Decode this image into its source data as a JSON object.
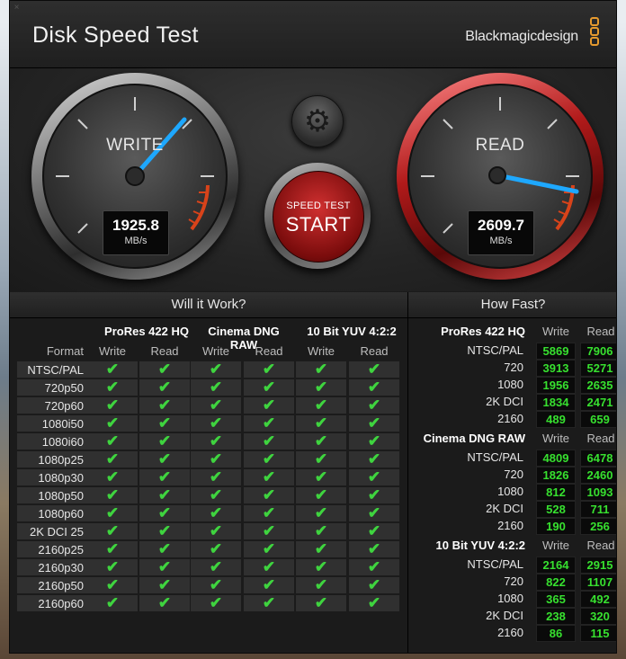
{
  "app": {
    "title": "Disk Speed Test",
    "brand": "Blackmagicdesign",
    "close_glyph": "×"
  },
  "gauges": {
    "write": {
      "label": "WRITE",
      "value": "1925.8",
      "unit": "MB/s"
    },
    "read": {
      "label": "READ",
      "value": "2609.7",
      "unit": "MB/s"
    }
  },
  "start_button": {
    "line1": "SPEED TEST",
    "line2": "START"
  },
  "settings_icon": "gear-icon",
  "will_it_work": {
    "title": "Will it Work?",
    "format_header": "Format",
    "groups": [
      "ProRes 422 HQ",
      "Cinema DNG RAW",
      "10 Bit YUV 4:2:2"
    ],
    "subheaders": [
      "Write",
      "Read"
    ],
    "check_glyph": "✔",
    "formats": [
      "NTSC/PAL",
      "720p50",
      "720p60",
      "1080i50",
      "1080i60",
      "1080p25",
      "1080p30",
      "1080p50",
      "1080p60",
      "2K DCI 25",
      "2160p25",
      "2160p30",
      "2160p50",
      "2160p60"
    ]
  },
  "how_fast": {
    "title": "How Fast?",
    "subheaders": [
      "Write",
      "Read"
    ],
    "groups": [
      {
        "name": "ProRes 422 HQ",
        "rows": [
          {
            "label": "NTSC/PAL",
            "write": "5869",
            "read": "7906"
          },
          {
            "label": "720",
            "write": "3913",
            "read": "5271"
          },
          {
            "label": "1080",
            "write": "1956",
            "read": "2635"
          },
          {
            "label": "2K DCI",
            "write": "1834",
            "read": "2471"
          },
          {
            "label": "2160",
            "write": "489",
            "read": "659"
          }
        ]
      },
      {
        "name": "Cinema DNG RAW",
        "rows": [
          {
            "label": "NTSC/PAL",
            "write": "4809",
            "read": "6478"
          },
          {
            "label": "720",
            "write": "1826",
            "read": "2460"
          },
          {
            "label": "1080",
            "write": "812",
            "read": "1093"
          },
          {
            "label": "2K DCI",
            "write": "528",
            "read": "711"
          },
          {
            "label": "2160",
            "write": "190",
            "read": "256"
          }
        ]
      },
      {
        "name": "10 Bit YUV 4:2:2",
        "rows": [
          {
            "label": "NTSC/PAL",
            "write": "2164",
            "read": "2915"
          },
          {
            "label": "720",
            "write": "822",
            "read": "1107"
          },
          {
            "label": "1080",
            "write": "365",
            "read": "492"
          },
          {
            "label": "2K DCI",
            "write": "238",
            "read": "320"
          },
          {
            "label": "2160",
            "write": "86",
            "read": "115"
          }
        ]
      }
    ]
  },
  "colors": {
    "accent_green": "#37e02f",
    "needle_blue": "#1ea8ff",
    "start_red": "#c02020",
    "brand_orange": "#e69a2e"
  }
}
